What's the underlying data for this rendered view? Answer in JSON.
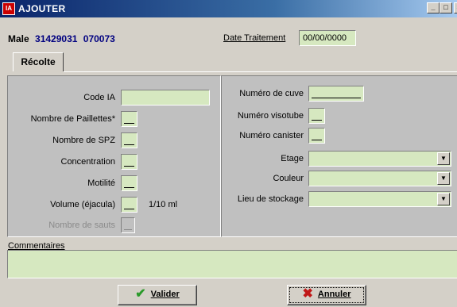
{
  "window": {
    "title": "AJOUTER",
    "icon": "app-icon",
    "controls": [
      "_",
      "□",
      "×"
    ]
  },
  "header": {
    "male_label": "Male",
    "male_id": "31429031",
    "male_code": "070073",
    "date_label": "Date Traitement",
    "date_value": "00/00/0000"
  },
  "tabs": [
    {
      "label": "Récolte",
      "selected": true
    }
  ],
  "left": {
    "code_ia": "Code IA",
    "paillettes": "Nombre de Paillettes*",
    "spz": "Nombre de SPZ",
    "concentration": "Concentration",
    "motilite": "Motilité",
    "volume": "Volume (éjacula)",
    "volume_unit": "1/10 ml",
    "sauts": "Nombre de sauts"
  },
  "right": {
    "cuve": "Numéro de cuve",
    "visotube": "Numéro visotube",
    "canister": "Numéro canister",
    "etage": "Etage",
    "couleur": "Couleur",
    "lieu": "Lieu de stockage"
  },
  "comments": {
    "label": "Commentaires",
    "value": ""
  },
  "buttons": {
    "valider": "Valider",
    "annuler": "Annuler"
  },
  "colors": {
    "field_bg": "#d6e8c0",
    "title_start": "#0a246a",
    "accent_id": "#000080"
  }
}
